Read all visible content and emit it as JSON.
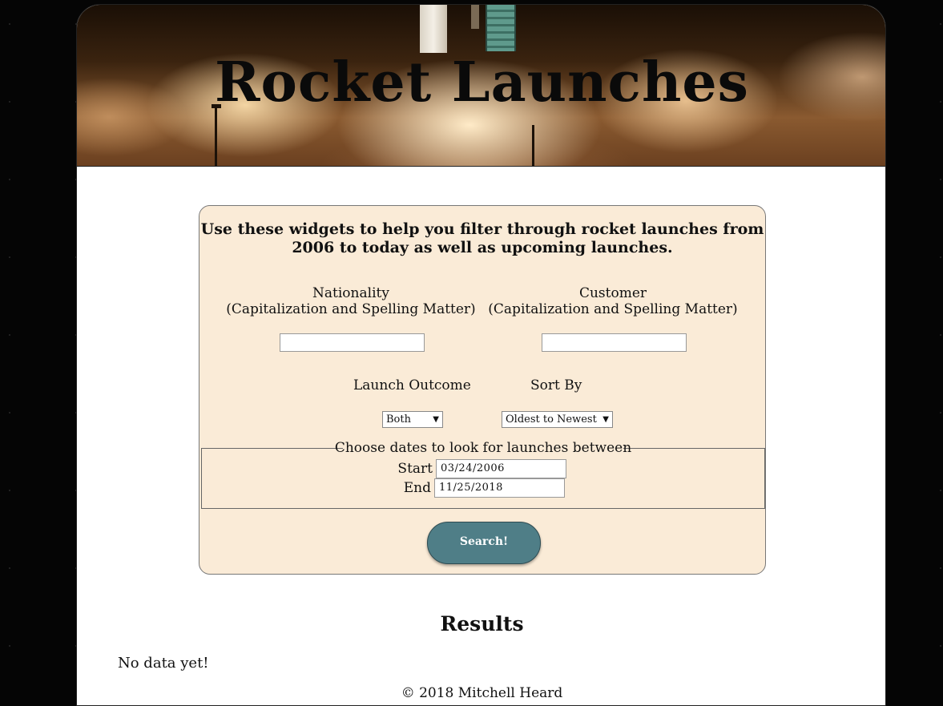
{
  "header": {
    "title": "Rocket Launches"
  },
  "filters": {
    "intro": "Use these widgets to help you filter through rocket launches from 2006 to today as well as upcoming launches.",
    "nationality": {
      "label": "Nationality",
      "hint": "(Capitalization and Spelling Matter)",
      "value": ""
    },
    "customer": {
      "label": "Customer",
      "hint": "(Capitalization and Spelling Matter)",
      "value": ""
    },
    "launch_outcome": {
      "label": "Launch Outcome",
      "selected": "Both"
    },
    "sort_by": {
      "label": "Sort By",
      "selected": "Oldest to Newest"
    },
    "dates": {
      "legend": "Choose dates to look for launches between",
      "start_label": "Start",
      "start_value": "03/24/2006",
      "end_label": "End",
      "end_value": "11/25/2018"
    },
    "search_label": "Search!"
  },
  "results": {
    "title": "Results",
    "empty_message": "No data yet!"
  },
  "footer": {
    "text": "© 2018 Mitchell Heard"
  },
  "colors": {
    "panel_background": "#faebd7",
    "button_background": "#4f7e87",
    "page_background": "#050505"
  },
  "icons": {
    "dropdown": "caret-down-icon"
  }
}
